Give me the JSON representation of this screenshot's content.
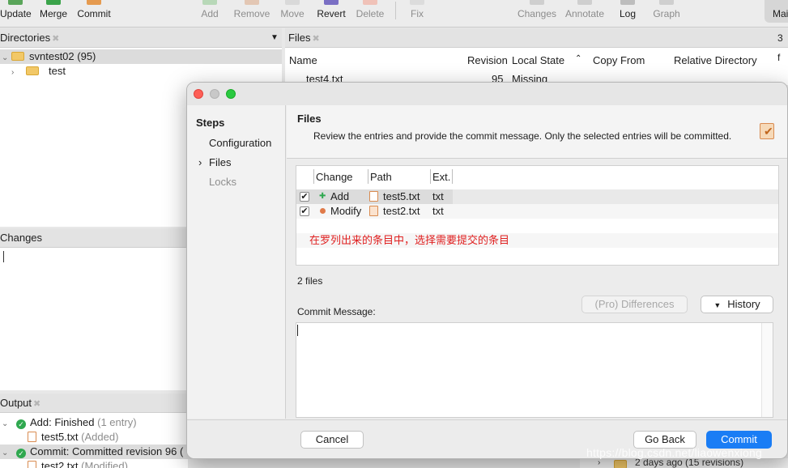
{
  "toolbar": {
    "items": [
      {
        "label": "Update",
        "icon": "update-icon"
      },
      {
        "label": "Merge",
        "icon": "merge-icon"
      },
      {
        "label": "Commit",
        "icon": "commit-icon"
      },
      {
        "label": "Add",
        "icon": "add-icon"
      },
      {
        "label": "Remove",
        "icon": "remove-icon"
      },
      {
        "label": "Move",
        "icon": "move-icon"
      },
      {
        "label": "Revert",
        "icon": "revert-icon"
      },
      {
        "label": "Delete",
        "icon": "delete-icon"
      },
      {
        "label": "Fix",
        "icon": "fix-icon"
      },
      {
        "label": "Changes",
        "icon": "changes-icon"
      },
      {
        "label": "Annotate",
        "icon": "annotate-icon"
      },
      {
        "label": "Log",
        "icon": "log-icon"
      },
      {
        "label": "Graph",
        "icon": "graph-icon"
      }
    ],
    "main_tab": "Mai"
  },
  "directories": {
    "title": "Directories",
    "root": "svntest02 (95)",
    "child": "test"
  },
  "files_pane": {
    "title": "Files",
    "count_partial": "3 f",
    "columns": [
      "Name",
      "Revision",
      "Local State",
      "Copy From",
      "Relative Directory"
    ],
    "row": {
      "name": "test4.txt",
      "revision": "95",
      "state": "Missing"
    }
  },
  "changes_pane": {
    "title": "Changes"
  },
  "output_pane": {
    "title": "Output",
    "entries": [
      {
        "label": "Add: Finished",
        "detail": "(1 entry)",
        "child": "test5.txt",
        "child_detail": "(Added)"
      },
      {
        "label": "Commit: Committed revision 96",
        "detail": "(",
        "child": "test2.txt",
        "child_detail": "(Modified)"
      }
    ]
  },
  "log_tail": "2 days ago (15 revisions)",
  "dialog": {
    "steps_title": "Steps",
    "steps": [
      "Configuration",
      "Files",
      "Locks"
    ],
    "active_step": "Files",
    "header_title": "Files",
    "header_desc": "Review the entries and provide the commit message. Only the selected entries will be committed.",
    "table": {
      "columns": [
        "Change",
        "Path",
        "Ext."
      ],
      "rows": [
        {
          "checked": true,
          "change": "Add",
          "path": "test5.txt",
          "ext": "txt"
        },
        {
          "checked": true,
          "change": "Modify",
          "path": "test2.txt",
          "ext": "txt"
        }
      ],
      "annotation": "在罗列出来的条目中，选择需要提交的条目"
    },
    "files_count": "2 files",
    "pro_differences": "(Pro) Differences",
    "history": "History",
    "commit_message_label": "Commit Message:",
    "commit_message_value": "",
    "cancel": "Cancel",
    "go_back": "Go Back",
    "commit": "Commit"
  },
  "watermark": "https://blog.csdn.net/liaowenxiong",
  "colors": {
    "accent": "#1a7df5",
    "annotation": "#e02020",
    "ok": "#2fa84f"
  }
}
